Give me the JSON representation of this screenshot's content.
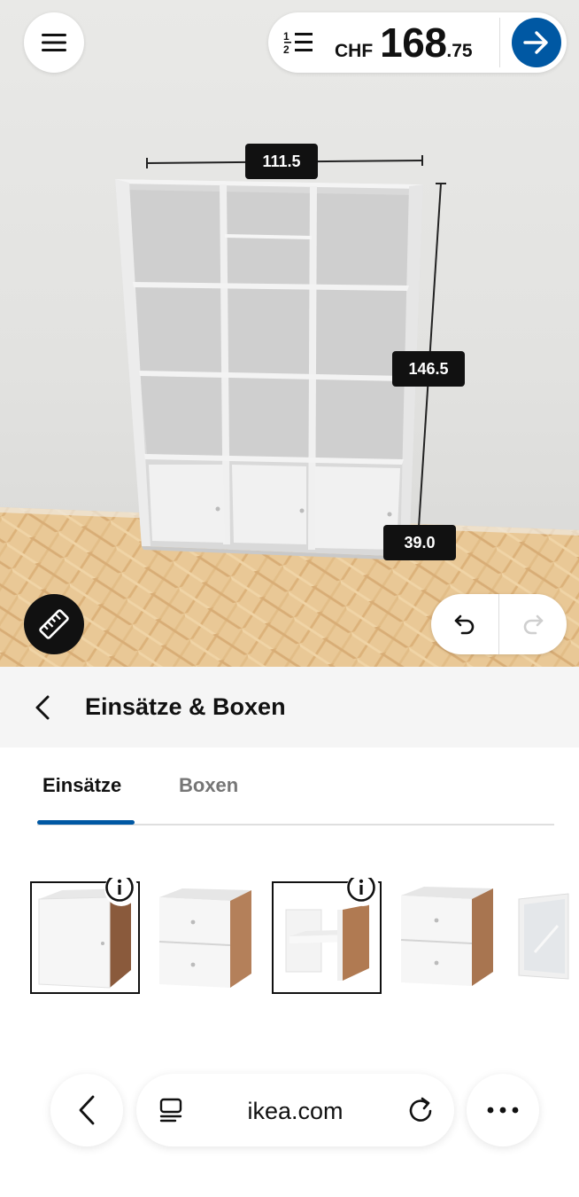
{
  "header": {
    "menu_icon": "hamburger-menu-icon",
    "list_icon": "numbered-list-icon",
    "price": {
      "currency": "CHF",
      "main": "168",
      "cents": ".75"
    },
    "proceed_icon": "arrow-right-icon",
    "accent_color": "#0058a3"
  },
  "scene": {
    "dimensions": {
      "width": "111.5",
      "height": "146.5",
      "depth": "39.0"
    },
    "measure_icon": "ruler-icon",
    "undo_icon": "undo-icon",
    "redo_icon": "redo-icon"
  },
  "panel": {
    "back_icon": "chevron-left-icon",
    "title": "Einsätze & Boxen",
    "tabs": [
      {
        "label": "Einsätze",
        "active": true
      },
      {
        "label": "Boxen",
        "active": false
      }
    ],
    "products": [
      {
        "name": "door-insert",
        "selected": true,
        "info_icon": "info-icon"
      },
      {
        "name": "drawer-insert-2",
        "selected": false
      },
      {
        "name": "shelf-insert",
        "selected": true,
        "info_icon": "info-icon"
      },
      {
        "name": "drawer-insert-2-alt",
        "selected": false
      },
      {
        "name": "mirror-door-insert",
        "selected": false
      }
    ]
  },
  "browser": {
    "back_icon": "chevron-left-icon",
    "tabs_icon": "tabs-icon",
    "url": "ikea.com",
    "reload_icon": "reload-icon",
    "more_icon": "more-dots-icon"
  }
}
